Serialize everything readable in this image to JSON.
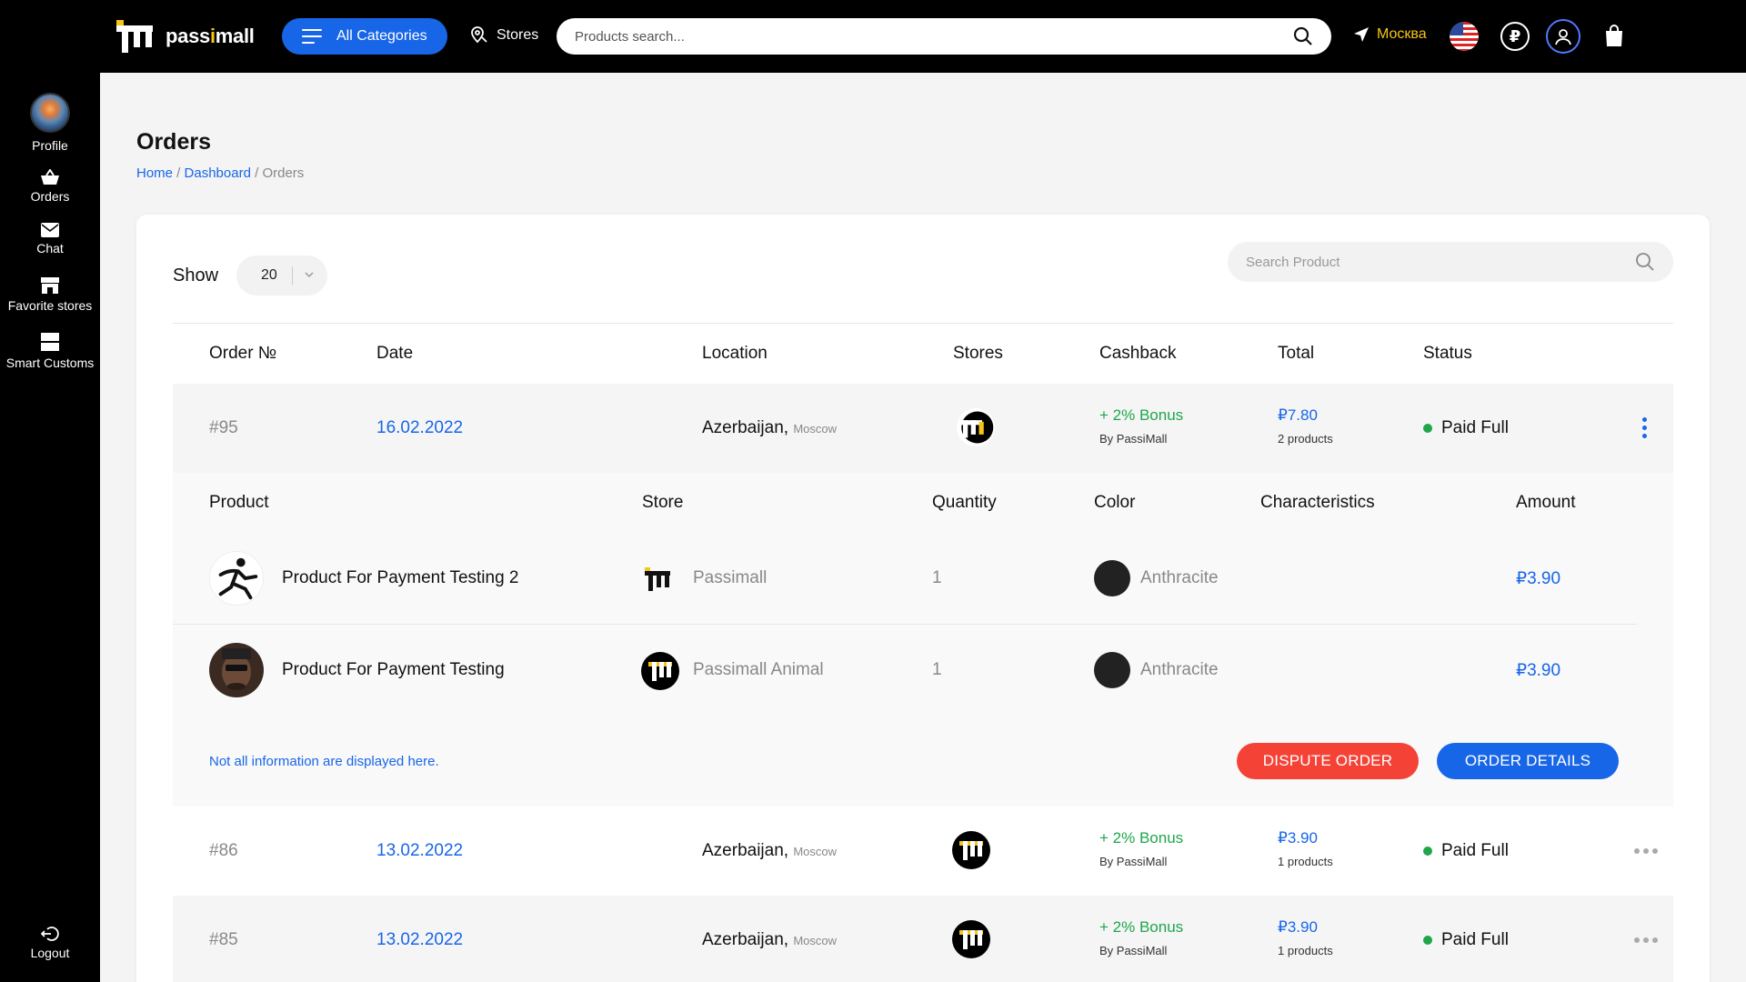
{
  "header": {
    "logo_text_a": "pass",
    "logo_text_b": "i",
    "logo_text_c": "mall",
    "categories_label": "All Categories",
    "stores_label": "Stores",
    "search_placeholder": "Products search...",
    "city": "Москва",
    "currency_symbol": "₽"
  },
  "sidebar": {
    "items": [
      {
        "label": "Profile"
      },
      {
        "label": "Orders"
      },
      {
        "label": "Chat"
      },
      {
        "label": "Favorite stores"
      },
      {
        "label": "Smart Customs"
      }
    ],
    "logout_label": "Logout"
  },
  "page": {
    "title": "Orders",
    "breadcrumb": {
      "home": "Home",
      "sep1": " / ",
      "dashboard": "Dashboard",
      "sep2": " / ",
      "current": "Orders"
    }
  },
  "controls": {
    "show_label": "Show",
    "show_value": "20",
    "search_placeholder": "Search Product"
  },
  "table": {
    "headers": {
      "order": "Order №",
      "date": "Date",
      "location": "Location",
      "stores": "Stores",
      "cashback": "Cashback",
      "total": "Total",
      "status": "Status"
    },
    "orders": [
      {
        "number": "#95",
        "date": "16.02.2022",
        "country": "Azerbaijan,",
        "city": "Moscow",
        "bonus": "+ 2% Bonus",
        "by": "By PassiMall",
        "total": "₽7.80",
        "products": "2 products",
        "status": "Paid Full"
      },
      {
        "number": "#86",
        "date": "13.02.2022",
        "country": "Azerbaijan,",
        "city": "Moscow",
        "bonus": "+ 2% Bonus",
        "by": "By PassiMall",
        "total": "₽3.90",
        "products": "1 products",
        "status": "Paid Full"
      },
      {
        "number": "#85",
        "date": "13.02.2022",
        "country": "Azerbaijan,",
        "city": "Moscow",
        "bonus": "+ 2% Bonus",
        "by": "By PassiMall",
        "total": "₽3.90",
        "products": "1 products",
        "status": "Paid Full"
      }
    ]
  },
  "details": {
    "headers": {
      "product": "Product",
      "store": "Store",
      "quantity": "Quantity",
      "color": "Color",
      "characteristics": "Characteristics",
      "amount": "Amount"
    },
    "items": [
      {
        "name": "Product For Payment Testing 2",
        "store": "Passimall",
        "quantity": "1",
        "color": "Anthracite",
        "amount": "₽3.90"
      },
      {
        "name": "Product For Payment Testing",
        "store": "Passimall Animal",
        "quantity": "1",
        "color": "Anthracite",
        "amount": "₽3.90"
      }
    ],
    "note": "Not all information are displayed here.",
    "dispute_label": "DISPUTE ORDER",
    "details_label": "ORDER DETAILS"
  },
  "colors": {
    "accent": "#1866e8",
    "brand_yellow": "#f5c518",
    "danger": "#f44336",
    "success": "#1fa64a"
  }
}
